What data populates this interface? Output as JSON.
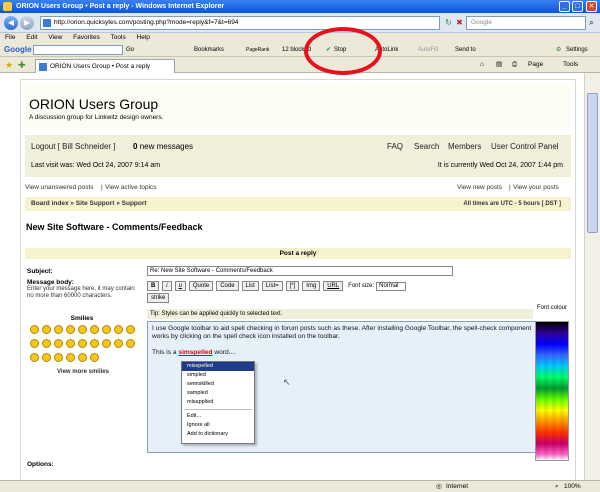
{
  "window": {
    "title": "ORION Users Group • Post a reply - Windows Internet Explorer",
    "minimize": "_",
    "maximize": "□",
    "close": "✕"
  },
  "address": {
    "back": "◀",
    "forward": "▶",
    "url": "http://orion.quicksytes.com/posting.php?mode=reply&f=7&t=694",
    "search_placeholder": "Google"
  },
  "menu": [
    "File",
    "Edit",
    "View",
    "Favorites",
    "Tools",
    "Help"
  ],
  "google_toolbar": {
    "logo": "Google",
    "go": "Go",
    "bookmarks": "Bookmarks",
    "pagerank": "PageRank",
    "blocked": "12 blocked",
    "check": "Stop",
    "autolink": "AutoLink",
    "autofill": "AutoFill",
    "send_to": "Send to",
    "settings": "Settings"
  },
  "tabs": {
    "page_tab": "ORION Users Group • Post a reply",
    "page_menu": "Page",
    "tools_menu": "Tools"
  },
  "forum": {
    "site_title": "ORION Users Group",
    "site_description": "A discussion group for Linkwitz design owners.",
    "logout": "Logout [ Bill Schneider ]",
    "new_messages_count": "0",
    "new_messages_label": "new messages",
    "nav_links": [
      "FAQ",
      "Search",
      "Members",
      "User Control Panel"
    ],
    "last_visit": "Last visit was: Wed Oct 24, 2007 9:14 am",
    "current_time": "It is currently Wed Oct 24, 2007 1:44 pm",
    "view_unanswered": "View unanswered posts",
    "view_active": "View active topics",
    "view_new": "View new posts",
    "view_your": "View your posts",
    "breadcrumb": "Board index » Site Support » Support",
    "timezone": "All times are UTC - 5 hours [ DST ]",
    "topic_title": "New Site Software - Comments/Feedback",
    "post_header": "Post a reply",
    "subject_label": "Subject:",
    "subject_value": "Re: New Site Software - Comments/Feedback",
    "body_label": "Message body:",
    "body_help": "Enter your message here, it may contain no more than 60000 characters.",
    "smilies_label": "Smilies",
    "view_more_smilies": "View more smilies",
    "bbcode_buttons": [
      "B",
      "i",
      "u",
      "Quote",
      "Code",
      "List",
      "List=",
      "[*]",
      "Img",
      "URL"
    ],
    "strike": "strike",
    "font_size_label": "Font size:",
    "font_size_value": "Normal",
    "tip": "Tip: Styles can be applied quickly to selected text.",
    "body_text_1": "I use Google toolbar to aid spell checking in forum posts such as these. After installing Google Toolbar, the spell-check component works by clicking on the spell check icon installed on the toolbar.",
    "body_text_2_prefix": "This is a",
    "body_text_2_word": "simspelled",
    "body_text_2_suffix": "word....",
    "font_colour": "Font colour",
    "options_label": "Options:"
  },
  "spell_menu": {
    "suggestions": [
      "misspelled",
      "simpled",
      "semiskilled",
      "sampled",
      "misapplied"
    ],
    "actions": [
      "Edit...",
      "Ignore all",
      "Add to dictionary"
    ]
  },
  "status": {
    "zone": "Internet",
    "zoom": "100%"
  },
  "colors": {
    "annotation": "#e8101b",
    "title_bar": "#0a56d8",
    "userbar_bg": "#f0efdc",
    "breadcrumb_bg": "#f7f3cf",
    "textarea_bg": "#e6f0fb",
    "misspelled": "#dd0000"
  }
}
